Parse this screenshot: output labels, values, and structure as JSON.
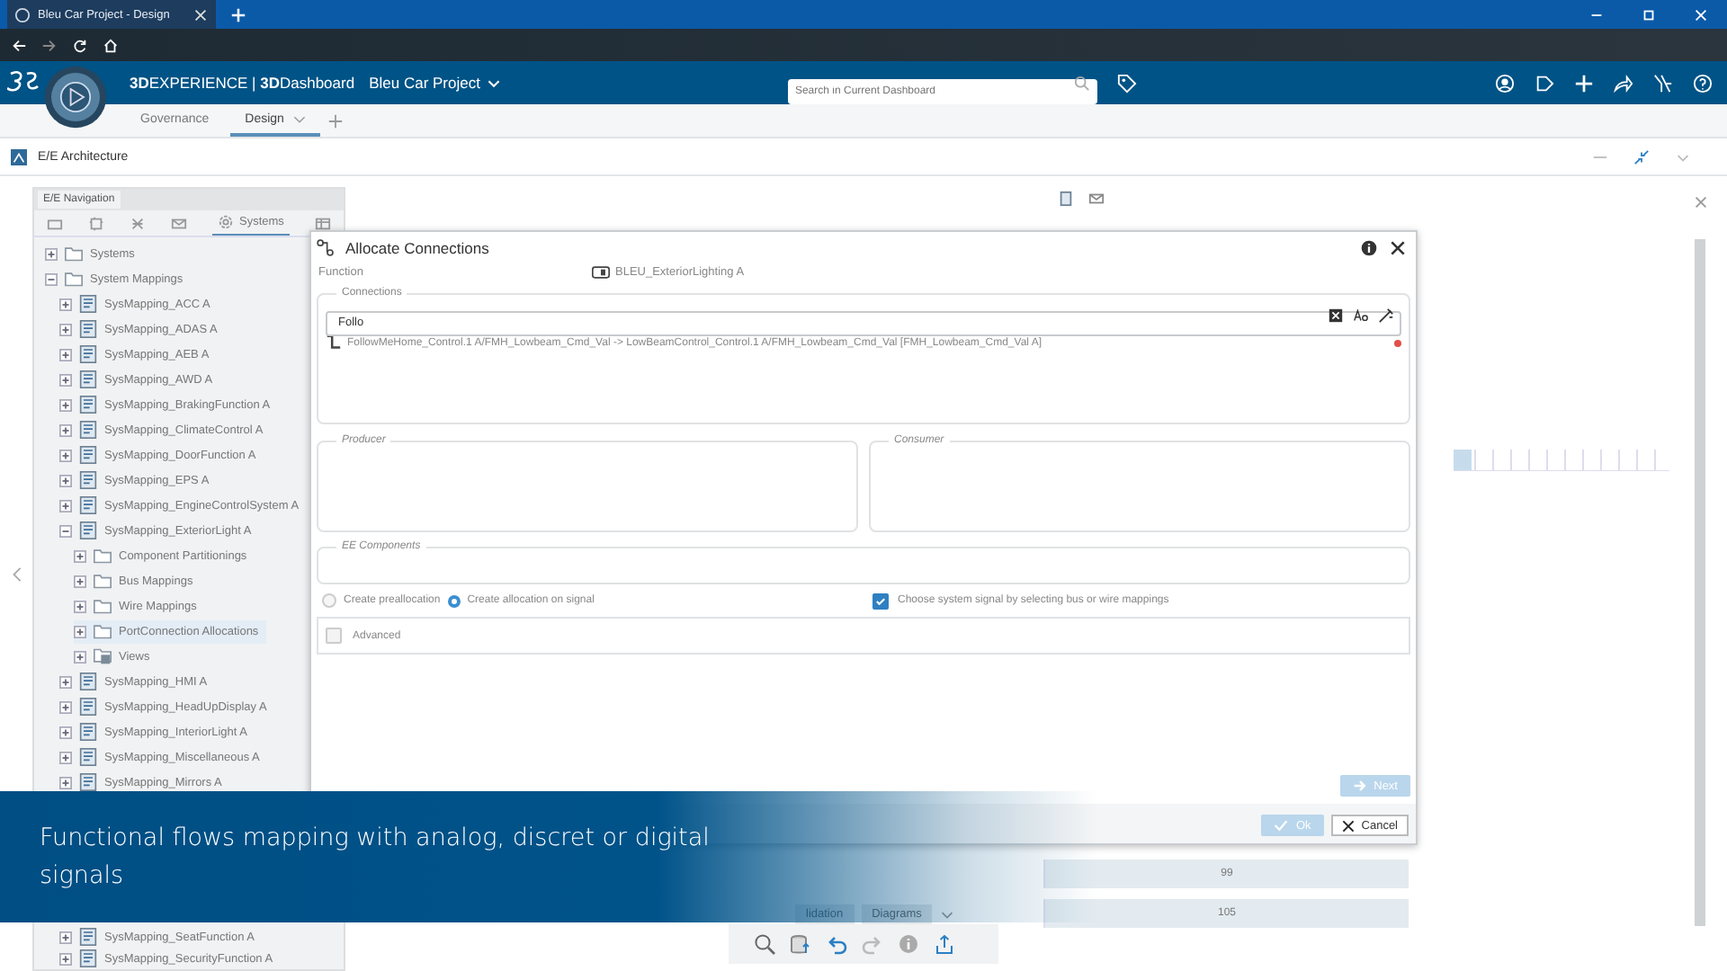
{
  "browser": {
    "tab_title": "Bleu Car Project - Design"
  },
  "header": {
    "brand": "**3D**EXPERIENCE | **3D**Dashboard",
    "project": "Bleu Car Project",
    "search": {
      "placeholder": "Search in Current Dashboard"
    }
  },
  "dashboard_tabs": [
    {
      "label": "Governance",
      "selected": false
    },
    {
      "label": "Design",
      "selected": true
    }
  ],
  "widget": {
    "title": "E/E Architecture"
  },
  "navigation": {
    "title": "E/E Navigation",
    "tab_label": "Systems",
    "tree": [
      {
        "label": "Systems",
        "kind": "folder",
        "expanded": false,
        "selected": false
      },
      {
        "label": "System Mappings",
        "kind": "folder",
        "expanded": true,
        "selected": false,
        "children": [
          {
            "label": "SysMapping_ACC A",
            "kind": "mapping",
            "expanded": false,
            "selected": false
          },
          {
            "label": "SysMapping_ADAS A",
            "kind": "mapping",
            "expanded": false,
            "selected": false
          },
          {
            "label": "SysMapping_AEB A",
            "kind": "mapping",
            "expanded": false,
            "selected": false
          },
          {
            "label": "SysMapping_AWD A",
            "kind": "mapping",
            "expanded": false,
            "selected": false
          },
          {
            "label": "SysMapping_BrakingFunction A",
            "kind": "mapping",
            "expanded": false,
            "selected": false
          },
          {
            "label": "SysMapping_ClimateControl A",
            "kind": "mapping",
            "expanded": false,
            "selected": false
          },
          {
            "label": "SysMapping_DoorFunction A",
            "kind": "mapping",
            "expanded": false,
            "selected": false
          },
          {
            "label": "SysMapping_EPS A",
            "kind": "mapping",
            "expanded": false,
            "selected": false
          },
          {
            "label": "SysMapping_EngineControlSystem A",
            "kind": "mapping",
            "expanded": false,
            "selected": false
          },
          {
            "label": "SysMapping_ExteriorLight A",
            "kind": "mapping",
            "expanded": true,
            "selected": false,
            "children": [
              {
                "label": "Component Partitionings",
                "kind": "folder",
                "expanded": false,
                "selected": false
              },
              {
                "label": "Bus Mappings",
                "kind": "folder",
                "expanded": false,
                "selected": false
              },
              {
                "label": "Wire Mappings",
                "kind": "folder",
                "expanded": false,
                "selected": false
              },
              {
                "label": "PortConnection Allocations",
                "kind": "folder",
                "expanded": false,
                "selected": true
              },
              {
                "label": "Views",
                "kind": "views",
                "expanded": false,
                "selected": false
              }
            ]
          },
          {
            "label": "SysMapping_HMI A",
            "kind": "mapping",
            "expanded": false,
            "selected": false
          },
          {
            "label": "SysMapping_HeadUpDisplay A",
            "kind": "mapping",
            "expanded": false,
            "selected": false
          },
          {
            "label": "SysMapping_InteriorLight A",
            "kind": "mapping",
            "expanded": false,
            "selected": false
          },
          {
            "label": "SysMapping_Miscellaneous A",
            "kind": "mapping",
            "expanded": false,
            "selected": false
          },
          {
            "label": "SysMapping_Mirrors A",
            "kind": "mapping",
            "expanded": false,
            "selected": false
          }
        ]
      }
    ],
    "tree_bottom": [
      {
        "label": "SysMapping_SeatFunction A",
        "kind": "mapping",
        "expanded": false,
        "selected": false
      },
      {
        "label": "SysMapping_SecurityFunction A",
        "kind": "mapping",
        "expanded": false,
        "selected": false
      }
    ]
  },
  "table": {
    "rows": [
      {
        "value": "99"
      },
      {
        "value": "105"
      }
    ]
  },
  "bottom_tabs": [
    {
      "label": "lidation"
    },
    {
      "label": "Diagrams"
    }
  ],
  "dialog": {
    "title": "Allocate Connections",
    "function_label": "Function",
    "function_value": "BLEU_ExteriorLighting A",
    "connections_legend": "Connections",
    "filter": {
      "value": "Follo"
    },
    "results": [
      {
        "text": "FollowMeHome_Control.1 A/FMH_Lowbeam_Cmd_Val -> LowBeamControl_Control.1 A/FMH_Lowbeam_Cmd_Val [FMH_Lowbeam_Cmd_Val A]",
        "error": true
      }
    ],
    "producer_legend": "Producer",
    "consumer_legend": "Consumer",
    "components_legend": "EE Components",
    "options": [
      {
        "label": "Create preallocation",
        "selected": false
      },
      {
        "label": "Create allocation on signal",
        "selected": true
      }
    ],
    "signal_checkbox": {
      "label": "Choose system signal by selecting bus or wire mappings",
      "checked": true
    },
    "advanced": {
      "label": "Advanced",
      "checked": false
    },
    "next_button": {
      "label": "Next",
      "disabled": true
    },
    "ok_button": {
      "label": "Ok",
      "disabled": true
    },
    "cancel_button": {
      "label": "Cancel",
      "disabled": false
    }
  },
  "caption": "Functional flows mapping with analog, discret or digital signals"
}
